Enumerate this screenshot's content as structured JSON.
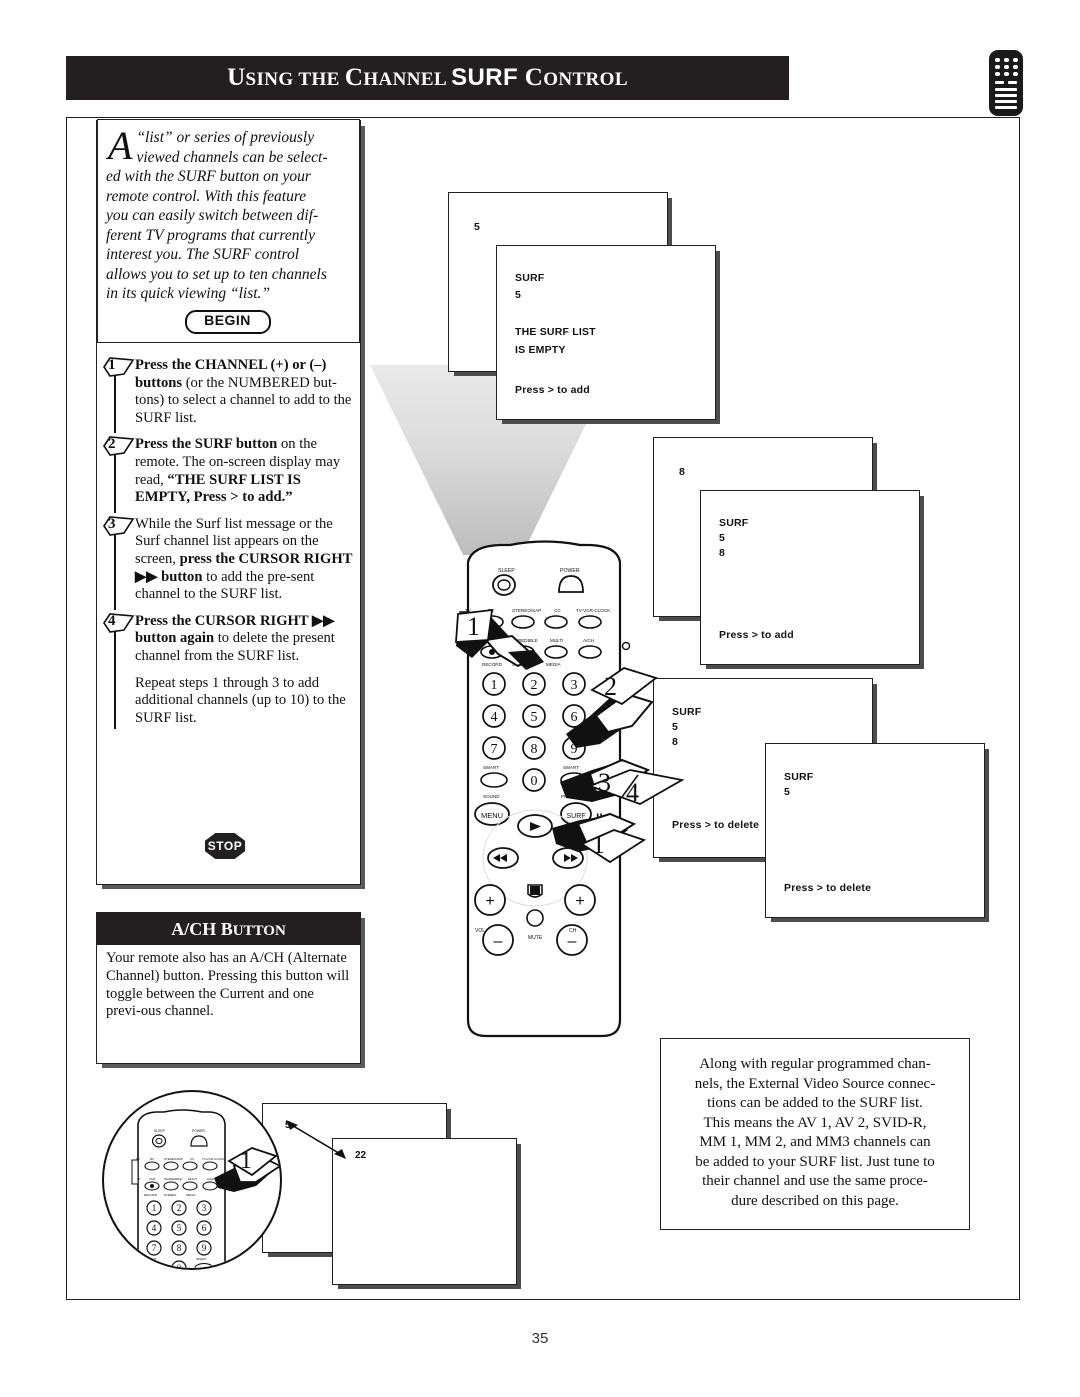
{
  "header": {
    "title_parts": [
      "U",
      "SING THE ",
      "C",
      "HANNEL ",
      "SURF",
      " C",
      "ONTROL"
    ],
    "title_plain": "Using the Channel SURF Control",
    "remote_icon": "remote-control-icon"
  },
  "intro": {
    "dropcap": "A",
    "body": "“list” or series of previously viewed channels can be select-ed with the SURF button on your remote control. With this feature you can easily switch between dif-ferent TV programs that currently interest you. The SURF control allows you to set up to ten channels in its quick viewing “list.”",
    "lines": [
      "“list” or series of previously",
      "viewed channels can be select-",
      "ed with the SURF button on your",
      "remote control. With this feature",
      "you can easily switch between dif-",
      "ferent TV programs that currently",
      "interest you. The SURF control",
      "allows you to set up to ten channels",
      "in its quick viewing “list.”"
    ],
    "begin_label": "BEGIN"
  },
  "steps": [
    {
      "number": "1",
      "bold_lead": "Press the CHANNEL (+) or (–) buttons",
      "rest": " (or the NUMBERED but-tons) to select a channel to add to the SURF list."
    },
    {
      "number": "2",
      "bold_lead": "Press the SURF button",
      "rest": " on the remote. The on-screen display may read, ",
      "bold_tail": "“THE SURF LIST IS EMPTY, Press > to add.”"
    },
    {
      "number": "3",
      "bold_lead": "",
      "rest": "While the Surf list message or the Surf channel list appears on the screen, ",
      "bold_mid": "press the CURSOR RIGHT ▶▶ button",
      "rest2": " to add the pre-sent channel to the SURF list."
    },
    {
      "number": "4",
      "bold_lead": "Press the CURSOR RIGHT ▶▶ button again",
      "rest": " to delete the present channel from the SURF list."
    }
  ],
  "repeat_note": "Repeat steps 1 through 3 to add additional channels (up to 10) to the SURF list.",
  "stop_label": "STOP",
  "ach_panel": {
    "heading_parts": [
      "A/CH B",
      "UTTON"
    ],
    "heading_plain": "A/CH Button",
    "body": "Your remote also has an A/CH (Alternate Channel) button. Pressing this button will toggle between the Current and one previ-ous channel."
  },
  "tv_screens": [
    {
      "id": "screen-1-back",
      "lines": [
        "5"
      ]
    },
    {
      "id": "screen-1-front",
      "lines": [
        "SURF",
        "5",
        "",
        "THE SURF LIST",
        "IS EMPTY",
        "",
        "Press > to add"
      ]
    },
    {
      "id": "screen-2-back",
      "lines": [
        "8"
      ]
    },
    {
      "id": "screen-2-front",
      "lines": [
        "SURF",
        "5",
        "8",
        "",
        "",
        "Press > to add"
      ]
    },
    {
      "id": "screen-3-back",
      "lines": [
        "SURF",
        "5",
        "8",
        "",
        "",
        "Press > to delete"
      ]
    },
    {
      "id": "screen-3-front",
      "lines": [
        "SURF",
        "5",
        "",
        "",
        "",
        "Press > to delete"
      ]
    },
    {
      "id": "screen-4-back",
      "lines": []
    },
    {
      "id": "screen-4-front",
      "lines": []
    }
  ],
  "callouts": {
    "remote_flags": [
      "1",
      "2",
      "3",
      "4",
      "1"
    ],
    "inset_flag": "1"
  },
  "inset": {
    "channel_from": "5",
    "channel_to": "22"
  },
  "info_box": {
    "text": "Along with regular programmed chan-nels, the External Video Source connec-tions can be added to the SURF list. This means the AV 1, AV 2, SVID-R, MM 1, MM 2, and MM3 channels can be added to your SURF list. Just tune to their channel and use the same proce-dure described on this page.",
    "lines": [
      "Along with regular programmed chan-",
      "nels, the External Video Source connec-",
      "tions can be added to the SURF list.",
      "This means the AV 1, AV 2, SVID-R,",
      "MM 1, MM 2, and MM3 channels can",
      "be added to your SURF list. Just tune to",
      "their channel and use the same proce-",
      "dure described on this page."
    ]
  },
  "remote_labels": {
    "row_top": [
      "SLEEP",
      "POWER"
    ],
    "row_a": [
      "TV",
      "RV",
      "STEREO/SAP",
      "CC",
      "TV-VCR-CLOCK"
    ],
    "row_b": [
      "VCR",
      "VCR",
      "INCREDIBLE",
      "MULTI",
      "A/CH"
    ],
    "row_b_sub": [
      "RECORD",
      "STEREO",
      "MEDIA"
    ],
    "keypad": [
      "1",
      "2",
      "3",
      "4",
      "5",
      "6",
      "7",
      "8",
      "9",
      "0"
    ],
    "smart_sound": "SMART SOUND",
    "smart_picture": "SMART PICTURE",
    "menu": "MENU",
    "surf": "SURF",
    "vol": "VOL",
    "mute": "MUTE"
  },
  "footer": {
    "page_number": "35"
  },
  "colors": {
    "ink": "#231f20",
    "page_bg": "#ffffff",
    "shadow": "#4d4d4d",
    "beam_top": "#e9e9e9",
    "beam_bottom": "#b9b9b9"
  }
}
